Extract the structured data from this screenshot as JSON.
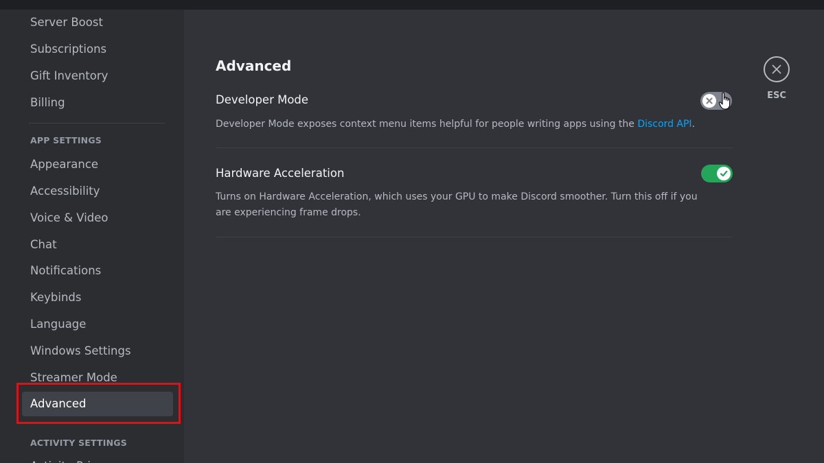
{
  "sidebar": {
    "items_top": [
      {
        "label": "Server Boost"
      },
      {
        "label": "Subscriptions"
      },
      {
        "label": "Gift Inventory"
      },
      {
        "label": "Billing"
      }
    ],
    "app_settings_header": "APP SETTINGS",
    "app_settings_items": [
      {
        "label": "Appearance"
      },
      {
        "label": "Accessibility"
      },
      {
        "label": "Voice & Video"
      },
      {
        "label": "Chat"
      },
      {
        "label": "Notifications"
      },
      {
        "label": "Keybinds"
      },
      {
        "label": "Language"
      },
      {
        "label": "Windows Settings"
      },
      {
        "label": "Streamer Mode"
      },
      {
        "label": "Advanced",
        "selected": true
      }
    ],
    "activity_settings_header": "ACTIVITY SETTINGS",
    "partial_item": "Activity Privacy"
  },
  "main": {
    "title": "Advanced",
    "settings": [
      {
        "label": "Developer Mode",
        "description_prefix": "Developer Mode exposes context menu items helpful for people writing apps using the ",
        "link_text": "Discord API",
        "description_suffix": ".",
        "toggle": "off"
      },
      {
        "label": "Hardware Acceleration",
        "description": "Turns on Hardware Acceleration, which uses your GPU to make Discord smoother. Turn this off if you are experiencing frame drops.",
        "toggle": "on"
      }
    ]
  },
  "close": {
    "label": "ESC",
    "icon": "close-icon"
  },
  "colors": {
    "background": "#313338",
    "sidebar": "#2b2d31",
    "selected_item": "#404249",
    "toggle_on": "#23a55a",
    "toggle_off": "#80848e",
    "link": "#00a8fc",
    "highlight_box": "#d3151c"
  }
}
